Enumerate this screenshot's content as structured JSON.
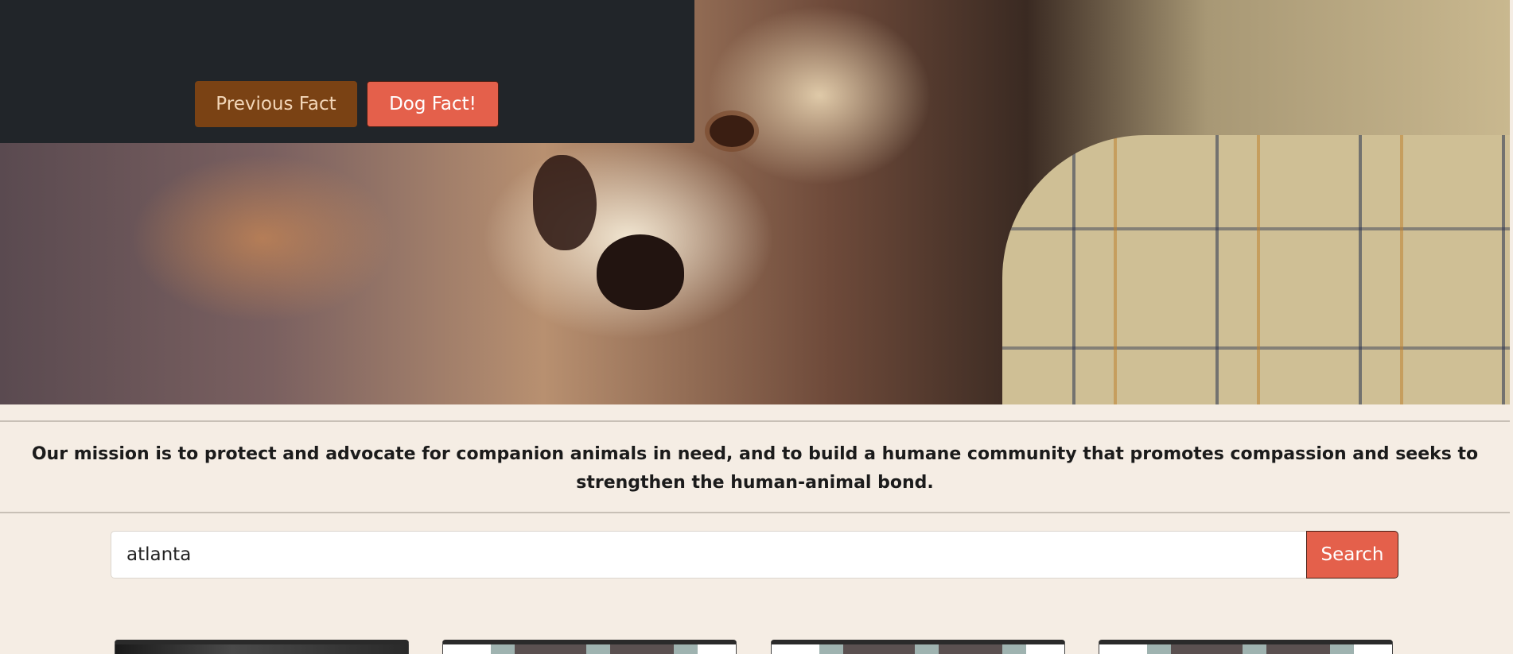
{
  "hero": {
    "image_alt": "dog resting head on person's shoulder"
  },
  "fact_panel": {
    "previous_label": "Previous Fact",
    "dog_fact_label": "Dog Fact!"
  },
  "mission": {
    "text": "Our mission is to protect and advocate for companion animals in need, and to build a humane community that promotes compassion and seeks to strengthen the human-animal bond."
  },
  "search": {
    "value": "atlanta",
    "button_label": "Search"
  },
  "cards": [
    {
      "thumb": "photo"
    },
    {
      "thumb": "placeholder"
    },
    {
      "thumb": "placeholder"
    },
    {
      "thumb": "placeholder"
    }
  ],
  "colors": {
    "accent": "#e4604b",
    "brown": "#7a4214",
    "dark_panel": "#212529",
    "page_bg": "#f5ede4"
  }
}
